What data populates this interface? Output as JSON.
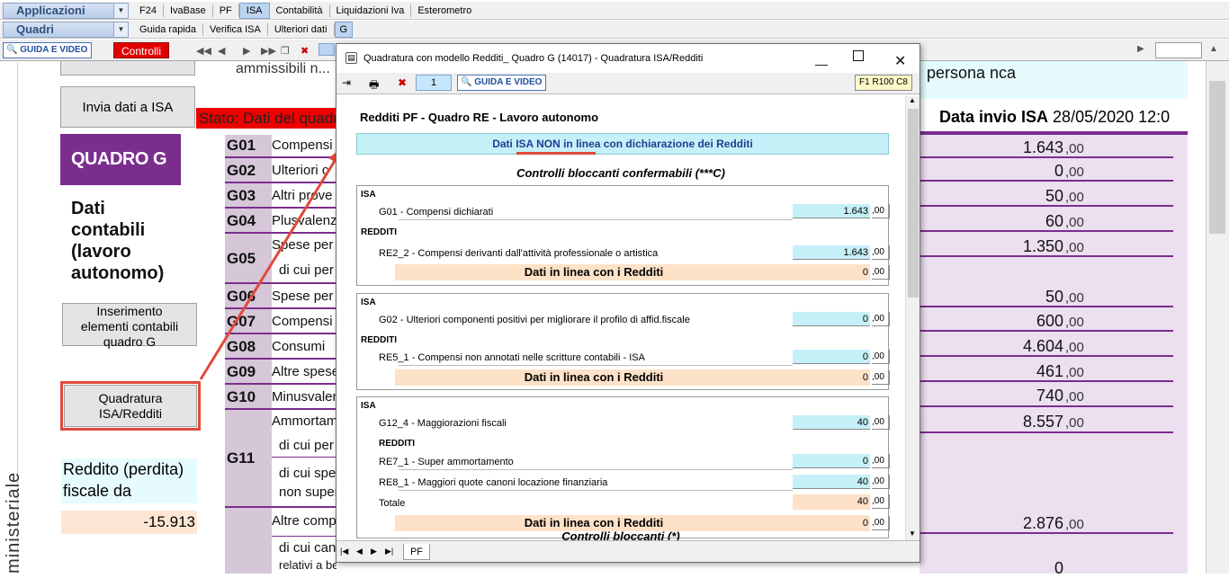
{
  "menu": {
    "applicazioni": "Applicazioni",
    "quadri": "Quadri",
    "app_items": [
      "F24",
      "IvaBase",
      "PF",
      "ISA",
      "Contabilità",
      "Liquidazioni Iva",
      "Esterometro"
    ],
    "quadri_items": [
      "Guida rapida",
      "Verifica ISA",
      "Ulteriori dati",
      "G"
    ]
  },
  "toolbar": {
    "guida_video": "GUIDA E VIDEO",
    "controlli": "Controlli"
  },
  "left": {
    "invia_btn": "Invia dati a ISA",
    "stato": "Stato: Dati del quadro",
    "top_text": "ammissibili n...",
    "quadro": "QUADRO G",
    "dati_title": [
      "Dati",
      "contabili",
      "(lavoro",
      "autonomo)"
    ],
    "inserimento_btn": [
      "Inserimento",
      "elementi contabili",
      "quadro G"
    ],
    "quadratura_btn": [
      "Quadratura",
      "ISA/Redditi"
    ],
    "reddito_label": [
      "Reddito (perdita)",
      "fiscale da"
    ],
    "reddito_value": "-15.913",
    "vertical": "ministeriale"
  },
  "gcodes": [
    {
      "code": "G01",
      "label": "Compensi"
    },
    {
      "code": "G02",
      "label": "Ulteriori c"
    },
    {
      "code": "G03",
      "label": "Altri prove"
    },
    {
      "code": "G04",
      "label": "Plusvalenze"
    },
    {
      "code": "G05",
      "label": "Spese per"
    },
    {
      "code": "G06",
      "label": "Spese per"
    },
    {
      "code": "G07",
      "label": "Compensi"
    },
    {
      "code": "G08",
      "label": "Consumi"
    },
    {
      "code": "G09",
      "label": "Altre spese"
    },
    {
      "code": "G10",
      "label": "Minusvalenze"
    },
    {
      "code": "G11",
      "label": "Ammortam"
    }
  ],
  "glabels_extra": [
    "di cui per",
    "di cui per",
    "di cui spe",
    "non super",
    "Altre comp",
    "di cui can",
    "relativi a beni immobili"
  ],
  "right": {
    "persona": "persona nca",
    "data_invio_label": "Data invio ISA",
    "data_invio_value": "28/05/2020 12:0",
    "values": [
      "1.643",
      "0",
      "50",
      "60",
      "1.350",
      "50",
      "600",
      "4.604",
      "461",
      "740",
      "8.557",
      "2.876",
      "0"
    ],
    "dec": ",00"
  },
  "dialog": {
    "title": "Quadratura con modello Redditi_ Quadro G (14017) - Quadratura ISA/Redditi",
    "page": "1",
    "guida": "GUIDA E VIDEO",
    "ref": "F1 R100 C8",
    "heading": "Redditi PF - Quadro RE - Lavoro autonomo",
    "banner": "Dati ISA NON in linea con dichiarazione dei Redditi",
    "subheading": "Controlli bloccanti confermabili (***C)",
    "isa": "ISA",
    "redditi": "REDDITI",
    "totale": "Totale",
    "in_linea": "Dati in linea con i Redditi",
    "dec": ",00",
    "rows": {
      "g01": {
        "label": "G01 - Compensi dichiarati",
        "value": "1.643"
      },
      "re2": {
        "label": "RE2_2 - Compensi derivanti dall'attività professionale o artistica",
        "value": "1.643"
      },
      "s1diff": "0",
      "g02": {
        "label": "G02 - Ulteriori componenti positivi per migliorare il profilo di affid.fiscale",
        "value": "0"
      },
      "re5": {
        "label": "RE5_1 - Compensi non annotati nelle scritture contabili - ISA",
        "value": "0"
      },
      "s2diff": "0",
      "g12": {
        "label": "G12_4 - Maggiorazioni fiscali",
        "value": "40"
      },
      "re7": {
        "label": "RE7_1 - Super ammortamento",
        "value": "0"
      },
      "re8": {
        "label": "RE8_1 - Maggiori quote canoni locazione finanziaria",
        "value": "40"
      },
      "tot": "40",
      "s3diff": "0"
    },
    "next": "Controlli bloccanti (*)",
    "tab": "PF"
  }
}
